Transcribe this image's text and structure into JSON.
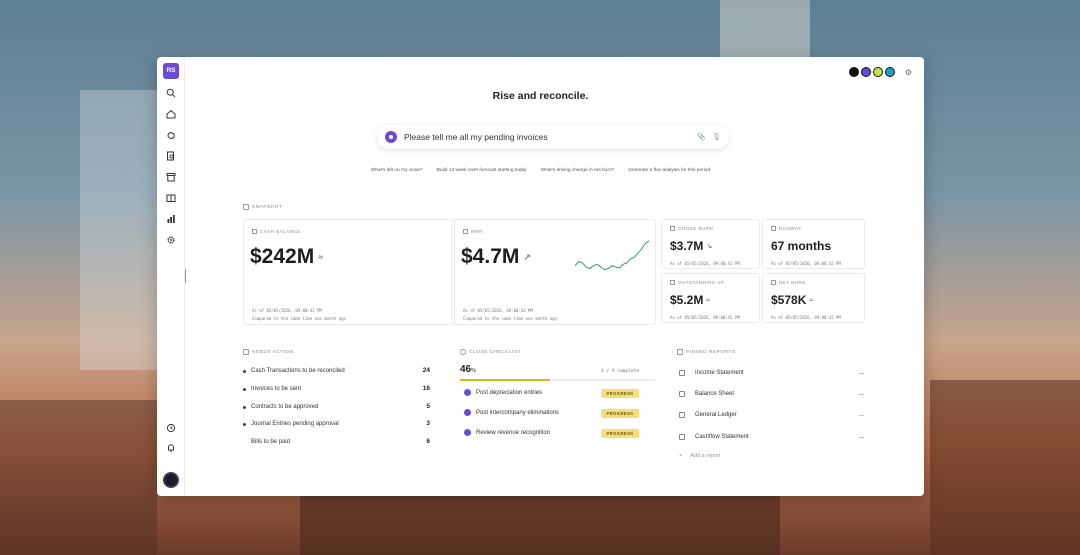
{
  "app": {
    "workspace_initials": "RS",
    "headline": "Rise and reconcile."
  },
  "prompt": {
    "text": "Please tell me all my pending invoices"
  },
  "suggestions": [
    "What's left on my close?",
    "Build 13 week cash forecast starting today",
    "What's driving change in net burn?",
    "Generate a flux analysis for this period"
  ],
  "snapshot": {
    "title": "Snapshot",
    "cash_balance": {
      "label": "Cash Balance",
      "value": "$242M",
      "as_of": "As of 05/05/2026, 09:00:42 PM",
      "compared": "Compared to the same time one month ago"
    },
    "mrr": {
      "label": "MRR",
      "value": "$4.7M",
      "as_of": "As of 05/05/2026, 09:00:42 PM",
      "compared": "Compared to the same time one month ago"
    },
    "gross_burn": {
      "label": "Gross Burn",
      "value": "$3.7M",
      "as_of": "As of 05/05/2026, 09:00:42 PM"
    },
    "runway": {
      "label": "Runway",
      "value": "67 months",
      "as_of": "As of 05/05/2026, 09:00:42 PM"
    },
    "outstanding_ap": {
      "label": "Outstanding AP",
      "value": "$5.2M",
      "as_of": "As of 05/05/2026, 09:00:42 PM"
    },
    "net_burn": {
      "label": "Net Burn",
      "value": "$578K",
      "as_of": "As of 05/05/2026, 09:00:42 PM"
    }
  },
  "needs_action": {
    "title": "Needs Action",
    "items": [
      {
        "label": "Cash Transactions to be reconciled",
        "count": "24"
      },
      {
        "label": "Invoices to be sent",
        "count": "16"
      },
      {
        "label": "Contracts to be approved",
        "count": "5"
      },
      {
        "label": "Journal Entries pending approval",
        "count": "3"
      },
      {
        "label": "Bills to be paid",
        "count": "6"
      }
    ]
  },
  "close_checklist": {
    "title": "Close Checklist",
    "percent": "46",
    "percent_symbol": "%",
    "progress_fraction": 0.46,
    "complete_text": "4 / 9 complete",
    "items": [
      {
        "label": "Post depreciation entries",
        "status": "PROGRESS"
      },
      {
        "label": "Post intercompany eliminations",
        "status": "PROGRESS"
      },
      {
        "label": "Review revenue recognition",
        "status": "PROGRESS"
      }
    ]
  },
  "pinned_reports": {
    "title": "Pinned Reports",
    "items": [
      {
        "label": "Income Statement"
      },
      {
        "label": "Balance Sheet"
      },
      {
        "label": "General Ledger"
      },
      {
        "label": "Cashflow Statement"
      }
    ],
    "add_label": "Add a report"
  },
  "chart_data": {
    "type": "line",
    "x": [
      0,
      1,
      2,
      3,
      4,
      5,
      6,
      7,
      8,
      9,
      10,
      11,
      12,
      13,
      14,
      15,
      16,
      17,
      18,
      19,
      20
    ],
    "y": [
      3.8,
      3.95,
      3.9,
      3.75,
      3.7,
      3.8,
      3.85,
      3.75,
      3.65,
      3.7,
      3.8,
      3.75,
      3.72,
      3.85,
      3.9,
      4.05,
      4.1,
      4.25,
      4.4,
      4.6,
      4.7
    ],
    "title": "",
    "xlabel": "",
    "ylabel": "",
    "ylim": [
      3.5,
      4.8
    ],
    "grid": false,
    "color": "#2e9c6a"
  },
  "colors": {
    "accent": "#6a4bd8",
    "progress": "#e2b21b",
    "badge": "#f7dc7c"
  }
}
